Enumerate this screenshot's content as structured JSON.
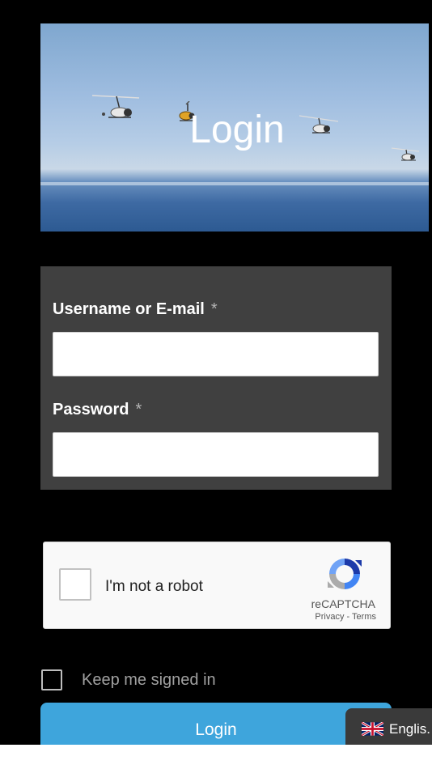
{
  "hero": {
    "title": "Login"
  },
  "form": {
    "username_label": "Username or E-mail",
    "username_required": "*",
    "username_value": "",
    "password_label": "Password",
    "password_required": "*",
    "password_value": ""
  },
  "captcha": {
    "checkbox_label": "I'm not a robot",
    "brand": "reCAPTCHA",
    "privacy": "Privacy",
    "separator": "-",
    "terms": "Terms"
  },
  "keep_signed_in": {
    "label": "Keep me signed in",
    "checked": false
  },
  "login_button": {
    "label": "Login"
  },
  "language": {
    "label": "Englis.",
    "icon": "uk-flag-icon"
  },
  "colors": {
    "page_background": "#000000",
    "form_background": "#404040",
    "login_button": "#3ea5dc",
    "language_badge": "#3a3a3a"
  }
}
